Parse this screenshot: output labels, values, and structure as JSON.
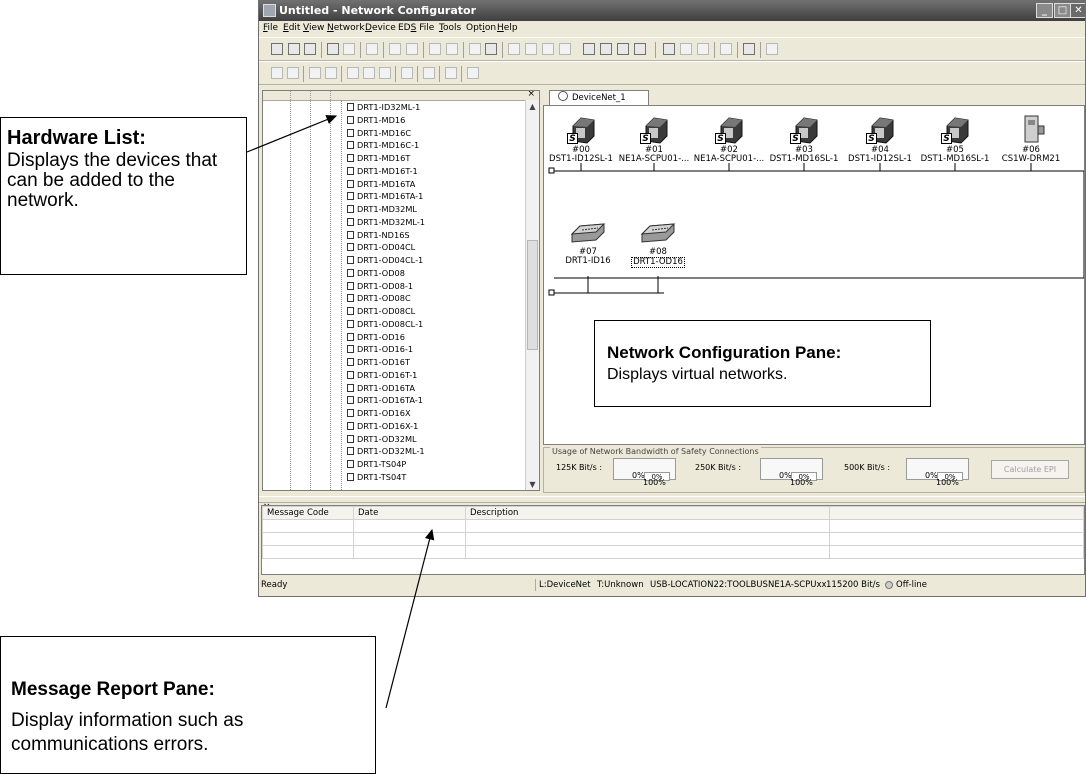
{
  "window": {
    "title": "Untitled - Network Configurator",
    "menu": [
      "File",
      "Edit",
      "View",
      "Network",
      "Device",
      "EDS File",
      "Tools",
      "Option",
      "Help"
    ]
  },
  "tree": {
    "items": [
      "DRT1-ID32ML-1",
      "DRT1-MD16",
      "DRT1-MD16C",
      "DRT1-MD16C-1",
      "DRT1-MD16T",
      "DRT1-MD16T-1",
      "DRT1-MD16TA",
      "DRT1-MD16TA-1",
      "DRT1-MD32ML",
      "DRT1-MD32ML-1",
      "DRT1-ND16S",
      "DRT1-OD04CL",
      "DRT1-OD04CL-1",
      "DRT1-OD08",
      "DRT1-OD08-1",
      "DRT1-OD08C",
      "DRT1-OD08CL",
      "DRT1-OD08CL-1",
      "DRT1-OD16",
      "DRT1-OD16-1",
      "DRT1-OD16T",
      "DRT1-OD16T-1",
      "DRT1-OD16TA",
      "DRT1-OD16TA-1",
      "DRT1-OD16X",
      "DRT1-OD16X-1",
      "DRT1-OD32ML",
      "DRT1-OD32ML-1",
      "DRT1-TS04P",
      "DRT1-TS04T"
    ]
  },
  "network": {
    "tab_label": "DeviceNet_1",
    "nodes_row1": [
      {
        "addr": "#00",
        "name": "DST1-ID12SL-1"
      },
      {
        "addr": "#01",
        "name": "NE1A-SCPU01-..."
      },
      {
        "addr": "#02",
        "name": "NE1A-SCPU01-..."
      },
      {
        "addr": "#03",
        "name": "DST1-MD16SL-1"
      },
      {
        "addr": "#04",
        "name": "DST1-ID12SL-1"
      },
      {
        "addr": "#05",
        "name": "DST1-MD16SL-1"
      },
      {
        "addr": "#06",
        "name": "CS1W-DRM21"
      }
    ],
    "nodes_row2": [
      {
        "addr": "#07",
        "name": "DRT1-ID16"
      },
      {
        "addr": "#08",
        "name": "DRT1-OD16"
      }
    ]
  },
  "bandwidth": {
    "title": "Usage of Network Bandwidth of Safety Connections",
    "rates": [
      "125K Bit/s :",
      "250K Bit/s :",
      "500K Bit/s :"
    ],
    "zero": "0%",
    "value": "0%",
    "max": "100%",
    "button": "Calculate EPI"
  },
  "messages": {
    "columns": [
      "Message Code",
      "Date",
      "Description"
    ]
  },
  "status": {
    "ready": "Ready",
    "fields": [
      "L:DeviceNet",
      "T:Unknown",
      "USB-LOCATION22:TOOLBUS",
      "NE1A-SCPUxx",
      "115200 Bit/s",
      "Off-line"
    ]
  },
  "callouts": {
    "hardware": {
      "title": "Hardware List:",
      "body": "Displays the devices that can be added to the network."
    },
    "network": {
      "title": "Network Configuration Pane:",
      "body": "Displays virtual networks."
    },
    "message": {
      "title": "Message Report Pane:",
      "body": "Display information such as communications errors."
    }
  }
}
